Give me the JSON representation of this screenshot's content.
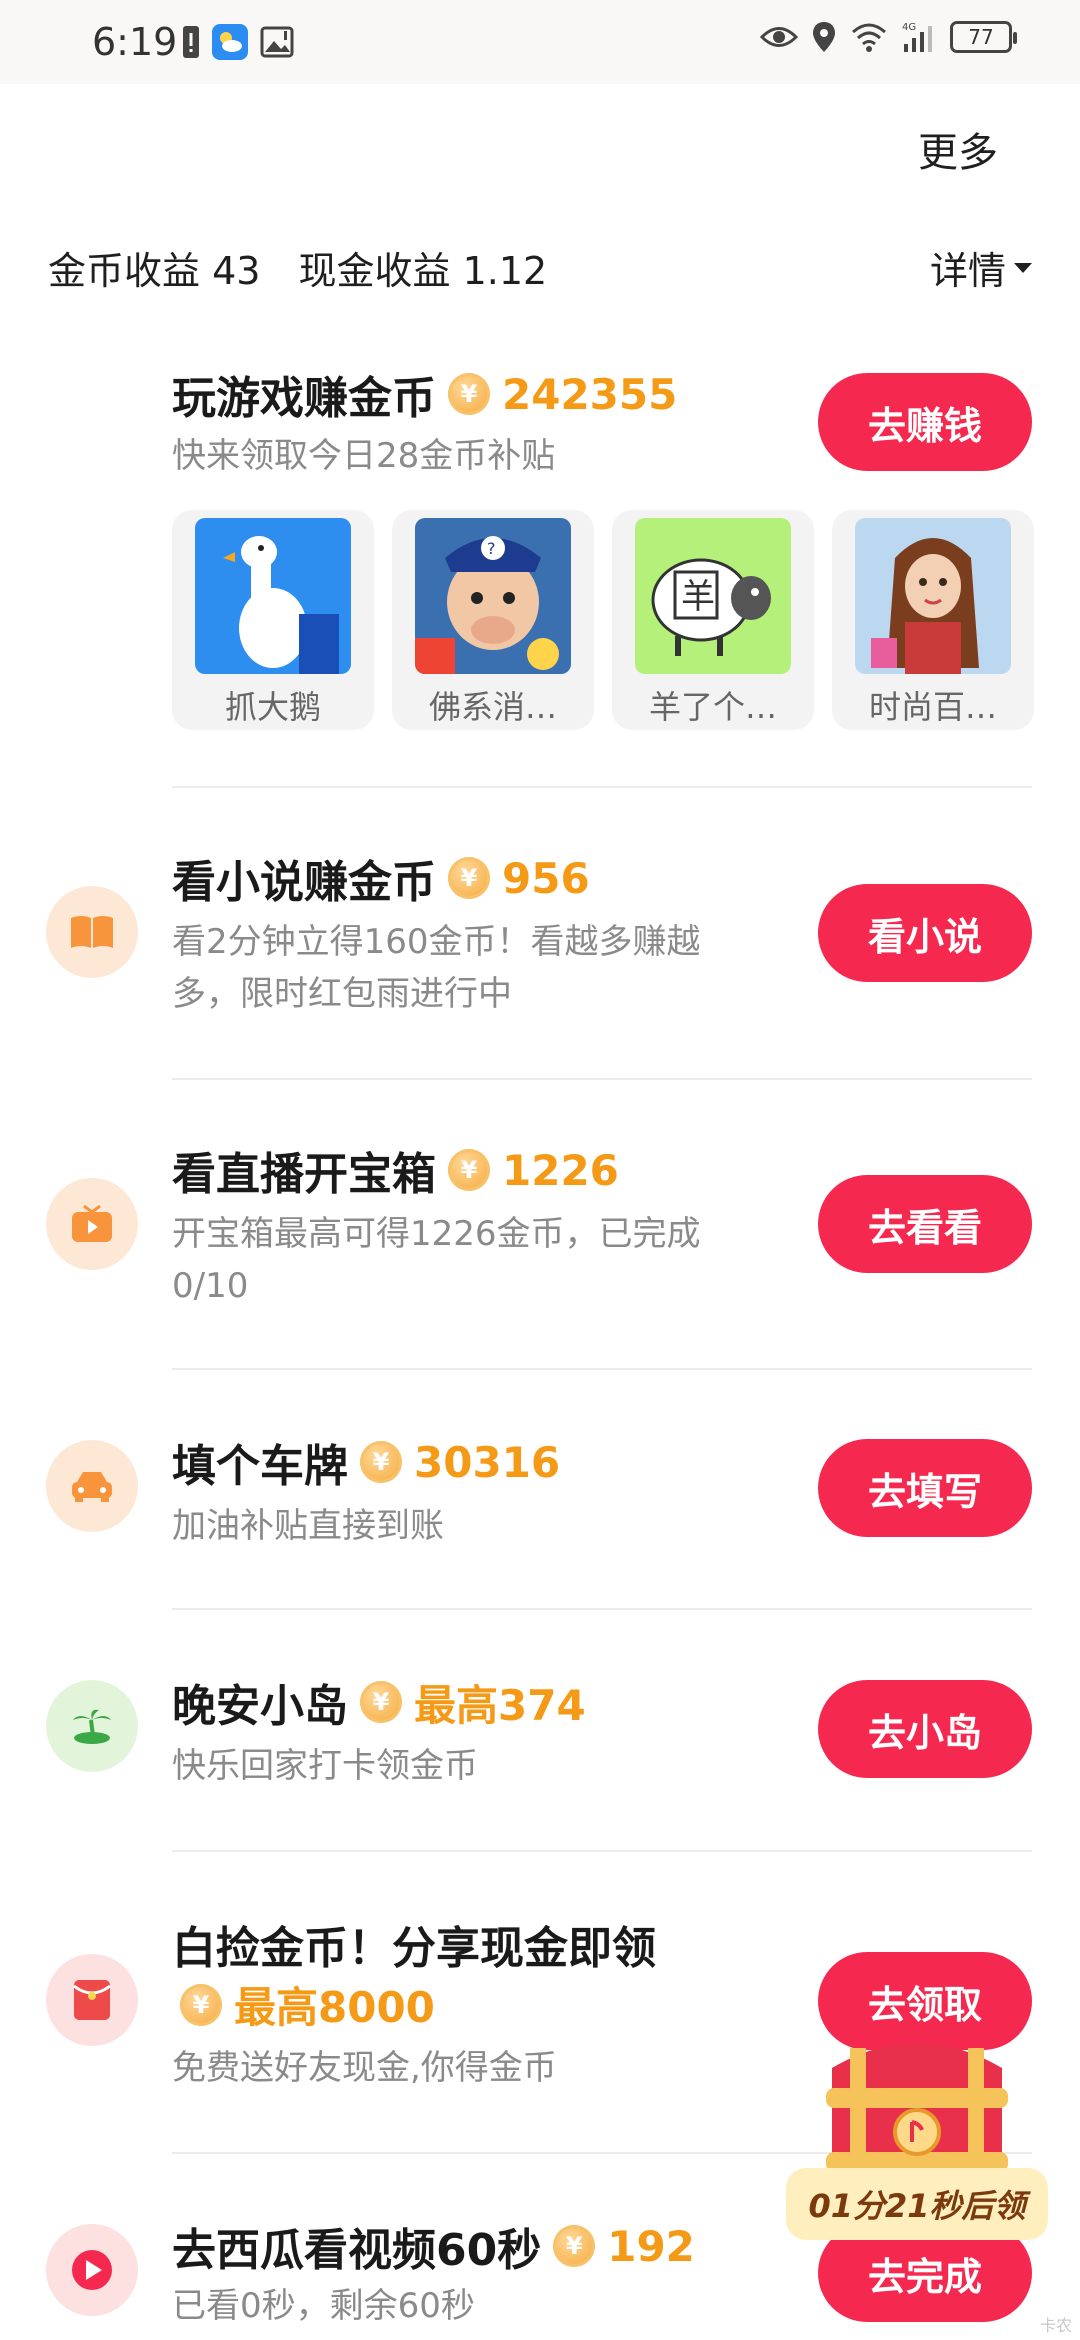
{
  "status_bar": {
    "time": "6:19",
    "network": "4G",
    "battery": "77",
    "icons": [
      "alert-icon",
      "weather-app-icon",
      "image-icon",
      "eye-icon",
      "location-icon",
      "wifi-icon",
      "signal-icon",
      "battery-icon"
    ]
  },
  "header": {
    "more": "更多",
    "coin_earnings_label": "金币收益",
    "coin_earnings_value": "43",
    "cash_earnings_label": "现金收益",
    "cash_earnings_value": "1.12",
    "details": "详情"
  },
  "tasks": [
    {
      "title": "玩游戏赚金币",
      "reward": "242355",
      "sub": "快来领取今日28金币补贴",
      "button": "去赚钱",
      "icon": ""
    },
    {
      "title": "看小说赚金币",
      "reward": "956",
      "sub": "看2分钟立得160金币！看越多赚越多，限时红包雨进行中",
      "button": "看小说",
      "icon": "book-icon"
    },
    {
      "title": "看直播开宝箱",
      "reward": "1226",
      "sub": "开宝箱最高可得1226金币，已完成0/10",
      "button": "去看看",
      "icon": "tv-icon"
    },
    {
      "title": "填个车牌",
      "reward": "30316",
      "sub": "加油补贴直接到账",
      "button": "去填写",
      "icon": "car-icon"
    },
    {
      "title": "晚安小岛",
      "reward": "最高374",
      "sub": "快乐回家打卡领金币",
      "button": "去小岛",
      "icon": "island-icon"
    },
    {
      "title": "白捡金币！分享现金即领",
      "reward": "最高8000",
      "sub": "免费送好友现金,你得金币",
      "button": "去领取",
      "icon": "red-envelope-icon"
    },
    {
      "title": "去西瓜看视频60秒",
      "reward": "192",
      "sub": "已看0秒，剩余60秒",
      "button": "去完成",
      "icon": "xigua-video-icon"
    }
  ],
  "games": [
    {
      "name": "抓大鹅"
    },
    {
      "name": "佛系消…"
    },
    {
      "name": "羊了个…"
    },
    {
      "name": "时尚百…"
    }
  ],
  "chest": {
    "timer": "01分21秒后领"
  },
  "watermark": "卡农",
  "colors": {
    "accent_button": "#f5294f",
    "reward_orange": "#f59a16",
    "sub_text": "#8a8a8a"
  }
}
